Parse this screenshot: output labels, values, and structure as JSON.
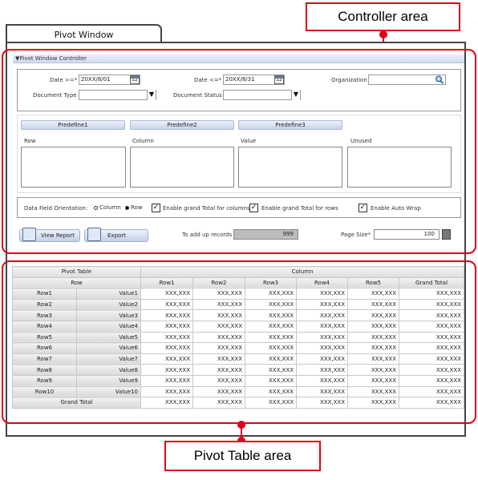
{
  "callouts": {
    "controller_area": "Controller area",
    "pivot_table_area": "Pivot Table area"
  },
  "window": {
    "tab_title": "Pivot Window"
  },
  "controller": {
    "header": "▼Pivot Window Controller",
    "date_from": {
      "label": "Date >=*",
      "value": "20XX/8/01",
      "icon_text": "12"
    },
    "date_to": {
      "label": "Date <=*",
      "value": "20XX/8/31",
      "icon_text": "12"
    },
    "organization": {
      "label": "Organization",
      "value": ""
    },
    "document_type": {
      "label": "Document Type",
      "value": ""
    },
    "document_status": {
      "label": "Document Status",
      "value": ""
    },
    "predefine": [
      "Predefine1",
      "Predefine2",
      "Predefine3"
    ],
    "lists": [
      "Row",
      "Column",
      "Value",
      "Unused"
    ],
    "orientation": {
      "label": "Data Field Orientation:",
      "column": "Column",
      "row": "Row",
      "selected": "Row"
    },
    "checks": {
      "grand_total_columns": "Enable grand Total for columns",
      "grand_total_rows": "Enable grand Total for rows",
      "auto_wrap": "Enable Auto Wrap",
      "mark": "✓"
    },
    "view_report": "View Report",
    "export": "Export",
    "records": {
      "label": "To add up records",
      "value": "999"
    },
    "page_size": {
      "label": "Page Size*",
      "value": "100"
    }
  },
  "pivot_table": {
    "title": "Pivot Table",
    "row_header": "Row",
    "column_header": "Column",
    "columns": [
      "Row1",
      "Row2",
      "Row3",
      "Row4",
      "Row5",
      "Grand Total"
    ],
    "rows": [
      {
        "row": "Row1",
        "value": "Value1"
      },
      {
        "row": "Row2",
        "value": "Value2"
      },
      {
        "row": "Row3",
        "value": "Value3"
      },
      {
        "row": "Row4",
        "value": "Value4"
      },
      {
        "row": "Row5",
        "value": "Value5"
      },
      {
        "row": "Row6",
        "value": "Value6"
      },
      {
        "row": "Row7",
        "value": "Value7"
      },
      {
        "row": "Row8",
        "value": "Value8"
      },
      {
        "row": "Row9",
        "value": "Value9"
      },
      {
        "row": "Row10",
        "value": "Value10"
      }
    ],
    "grand_total_label": "Grand Total",
    "cell_value": "XXX,XXX"
  },
  "colors": {
    "callout_red": "#e0001b",
    "header_blue": "#cfdaee"
  }
}
